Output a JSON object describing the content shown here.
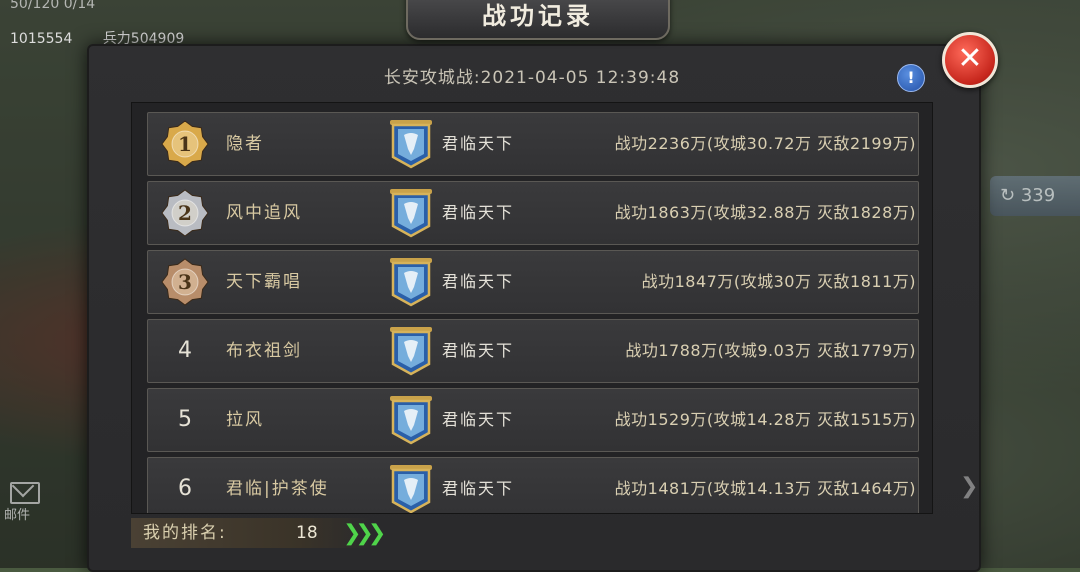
{
  "hud": {
    "top_partial": "50/120   0/14",
    "resource_value": "1015554",
    "troops_label": "兵力504909"
  },
  "side_badge": "339",
  "mail_label": "邮件",
  "title": "战功记录",
  "subtitle": "长安攻城战:2021-04-05 12:39:48",
  "info_label": "!",
  "close_label": "✕",
  "medal_colors": {
    "gold": "#d9a94a",
    "silver": "#b9bcc2",
    "bronze": "#b88d6a"
  },
  "rows": [
    {
      "rank": "1",
      "medal": "gold",
      "name": "隐者",
      "guild": "君临天下",
      "stats": "战功2236万(攻城30.72万 灭敌2199万)"
    },
    {
      "rank": "2",
      "medal": "silver",
      "name": "风中追风",
      "guild": "君临天下",
      "stats": "战功1863万(攻城32.88万 灭敌1828万)"
    },
    {
      "rank": "3",
      "medal": "bronze",
      "name": "天下霸唱",
      "guild": "君临天下",
      "stats": "战功1847万(攻城30万 灭敌1811万)"
    },
    {
      "rank": "4",
      "medal": "",
      "name": "布衣祖剑",
      "guild": "君临天下",
      "stats": "战功1788万(攻城9.03万 灭敌1779万)"
    },
    {
      "rank": "5",
      "medal": "",
      "name": "拉风",
      "guild": "君临天下",
      "stats": "战功1529万(攻城14.28万 灭敌1515万)"
    },
    {
      "rank": "6",
      "medal": "",
      "name": "君临|护茶使",
      "guild": "君临天下",
      "stats": "战功1481万(攻城14.13万 灭敌1464万)"
    }
  ],
  "my_rank": {
    "label": "我的排名:",
    "value": "18"
  }
}
